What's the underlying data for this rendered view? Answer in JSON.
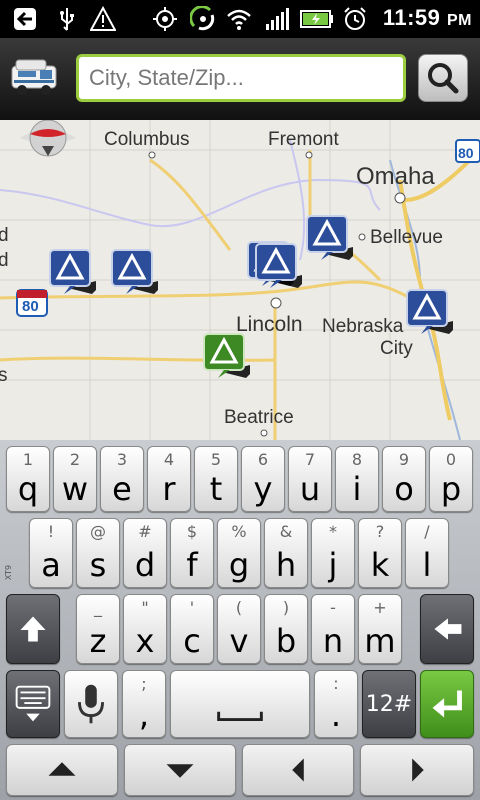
{
  "status_bar": {
    "time": "11:59",
    "ampm": "PM",
    "icons": [
      "usb-debug-icon",
      "usb-icon",
      "warning-icon",
      "gps-icon",
      "sync-icon",
      "wifi-icon",
      "signal-icon",
      "battery-icon",
      "alarm-icon"
    ]
  },
  "toolbar": {
    "app_icon": "rv-icon",
    "search_placeholder": "City, State/Zip...",
    "search_value": "",
    "search_button_icon": "search-icon"
  },
  "map": {
    "labels": [
      "Columbus",
      "Fremont",
      "Omaha",
      "Bellevue",
      "Lincoln",
      "Nebraska",
      "City",
      "Beatrice",
      "80",
      "80",
      "d",
      "d",
      "s"
    ],
    "compass_icon": "compass-icon",
    "pins": [
      {
        "type": "campground",
        "color": "#2c4d9a"
      },
      {
        "type": "campground",
        "color": "#2c4d9a"
      },
      {
        "type": "campground",
        "color": "#2c4d9a"
      },
      {
        "type": "campground",
        "color": "#2c4d9a"
      },
      {
        "type": "campground",
        "color": "#2c4d9a"
      },
      {
        "type": "campground",
        "color": "#2c4d9a"
      },
      {
        "type": "campground-selected",
        "color": "#3d8a24"
      }
    ]
  },
  "keyboard": {
    "row1": [
      {
        "alt": "1",
        "main": "q"
      },
      {
        "alt": "2",
        "main": "w"
      },
      {
        "alt": "3",
        "main": "e"
      },
      {
        "alt": "4",
        "main": "r"
      },
      {
        "alt": "5",
        "main": "t"
      },
      {
        "alt": "6",
        "main": "y"
      },
      {
        "alt": "7",
        "main": "u"
      },
      {
        "alt": "8",
        "main": "i"
      },
      {
        "alt": "9",
        "main": "o"
      },
      {
        "alt": "0",
        "main": "p"
      }
    ],
    "row2": [
      {
        "alt": "!",
        "main": "a"
      },
      {
        "alt": "@",
        "main": "s"
      },
      {
        "alt": "#",
        "main": "d"
      },
      {
        "alt": "$",
        "main": "f"
      },
      {
        "alt": "%",
        "main": "g"
      },
      {
        "alt": "&",
        "main": "h"
      },
      {
        "alt": "*",
        "main": "j"
      },
      {
        "alt": "?",
        "main": "k"
      },
      {
        "alt": "/",
        "main": "l"
      }
    ],
    "row3": [
      {
        "alt": "_",
        "main": "z"
      },
      {
        "alt": "\"",
        "main": "x"
      },
      {
        "alt": "'",
        "main": "c"
      },
      {
        "alt": "(",
        "main": "v"
      },
      {
        "alt": ")",
        "main": "b"
      },
      {
        "alt": "-",
        "main": "n"
      },
      {
        "alt": "+",
        "main": "m"
      }
    ],
    "row4": {
      "comma_alt": ";",
      "comma": ",",
      "period_alt": ":",
      "period": ".",
      "symbols": "12#"
    },
    "side_label": "XT9",
    "icons": [
      "shift-icon",
      "backspace-icon",
      "keyboard-hide-icon",
      "microphone-icon",
      "space-icon",
      "enter-icon",
      "arrow-up-icon",
      "arrow-down-icon",
      "arrow-left-icon",
      "arrow-right-icon"
    ]
  },
  "colors": {
    "accent": "#9ccc3f",
    "pin_blue": "#2c4d9a",
    "pin_green": "#3d8a24",
    "map_bg": "#ecebe6"
  }
}
